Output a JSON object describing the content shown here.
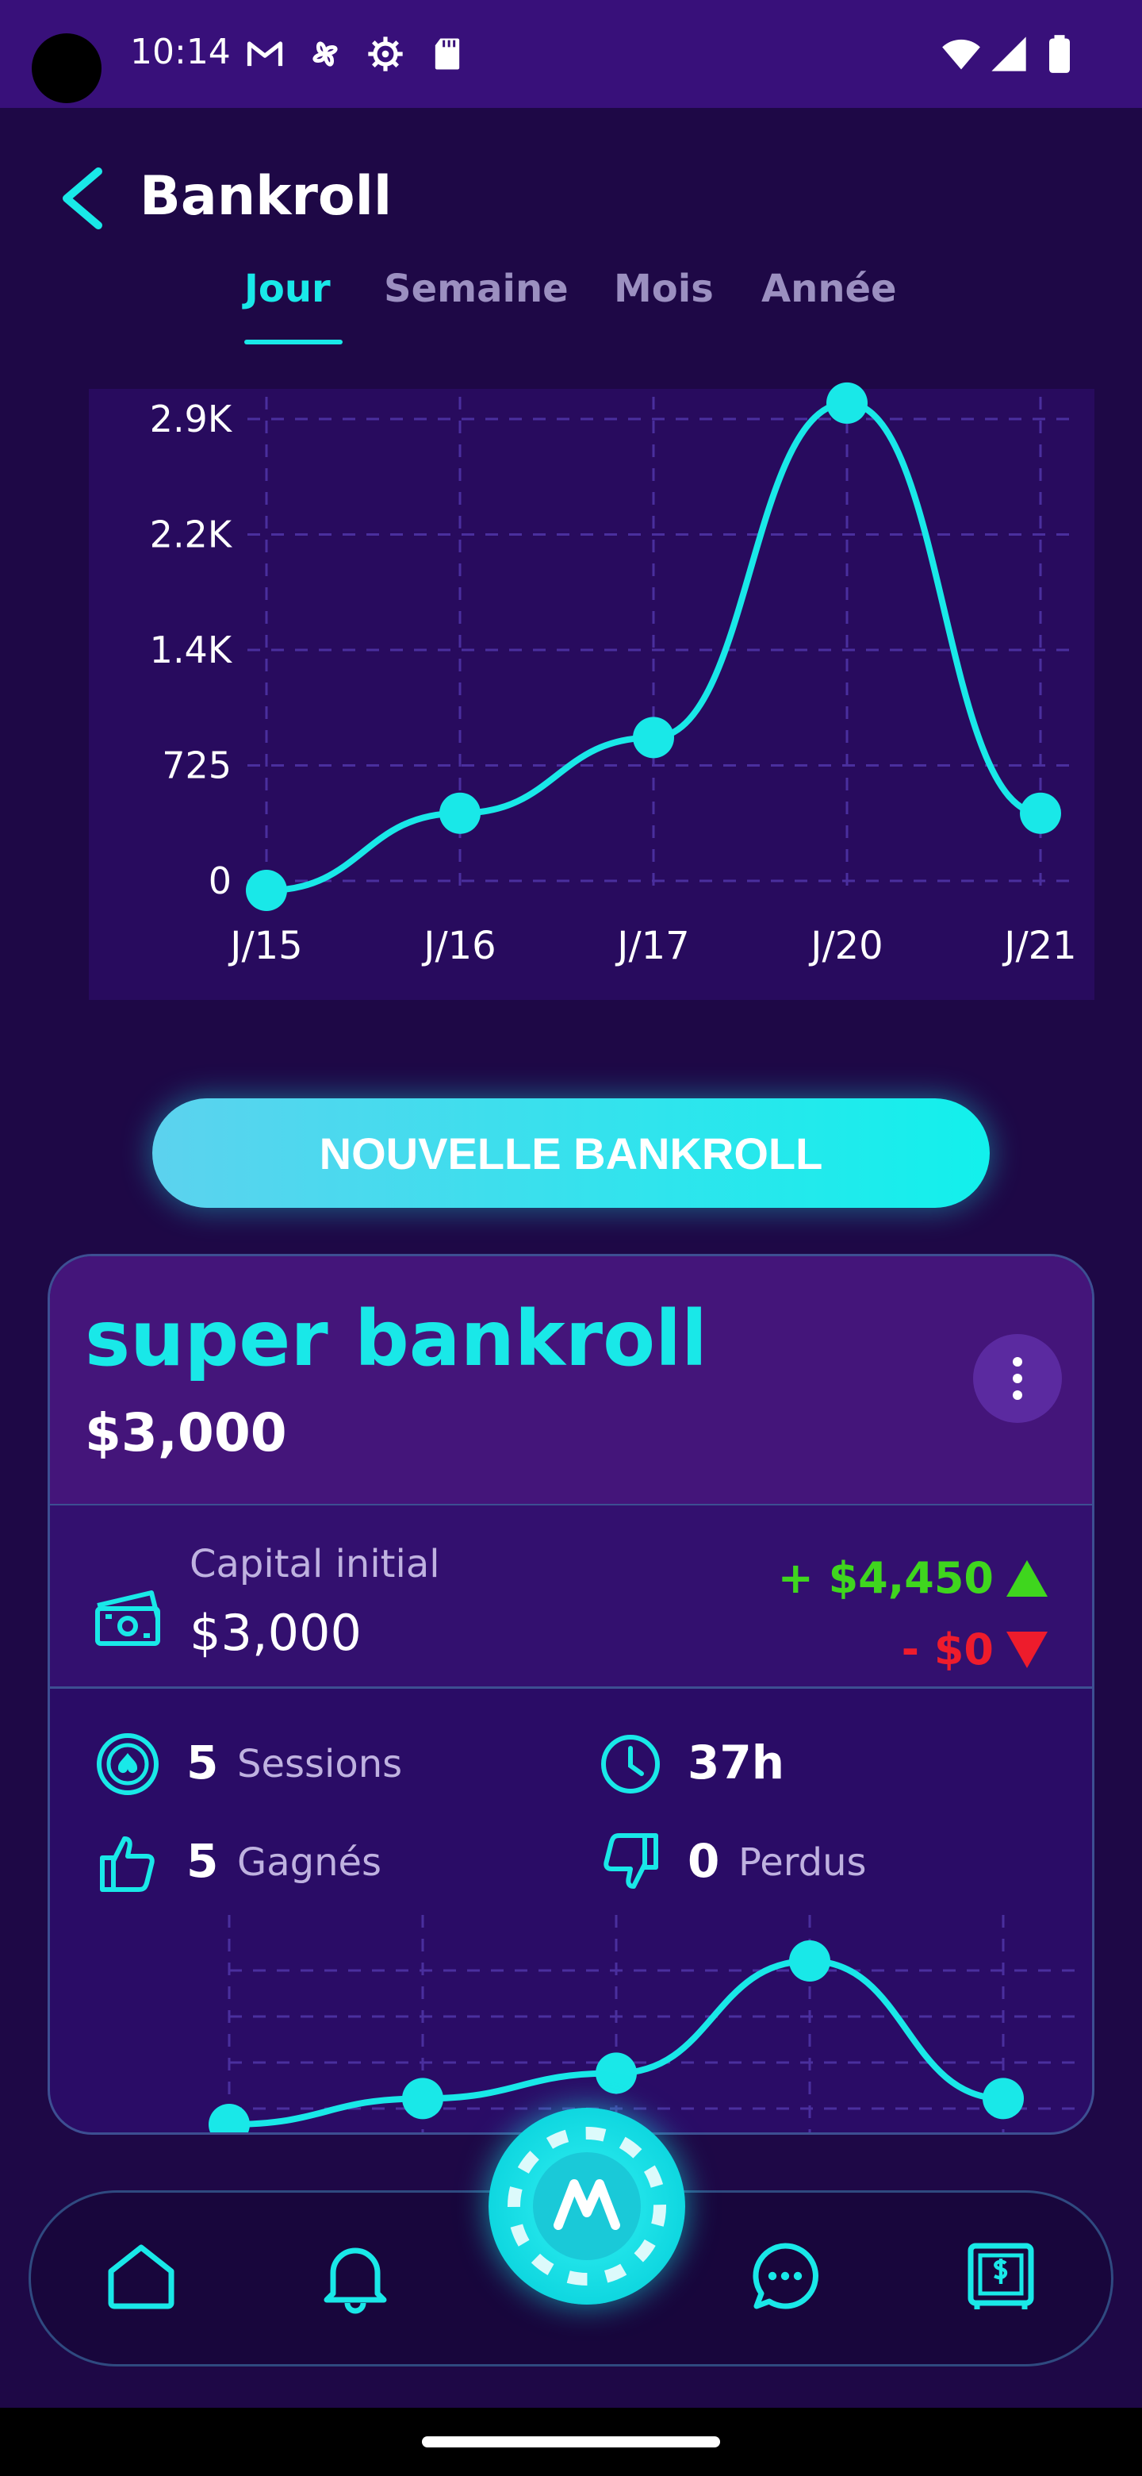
{
  "status_bar": {
    "time": "10:14",
    "left_icons": [
      "gmail-icon",
      "pinwheel-icon",
      "settings-icon",
      "sd-card-icon"
    ],
    "right_icons": [
      "wifi-icon",
      "signal-icon",
      "battery-icon"
    ]
  },
  "header": {
    "title": "Bankroll",
    "back_icon": "chevron-left-icon"
  },
  "tabs": [
    {
      "label": "Jour",
      "active": true
    },
    {
      "label": "Semaine",
      "active": false
    },
    {
      "label": "Mois",
      "active": false
    },
    {
      "label": "Année",
      "active": false
    }
  ],
  "chart_data": {
    "type": "line",
    "title": "",
    "xlabel": "",
    "ylabel": "",
    "categories": [
      "J/15",
      "J/16",
      "J/17",
      "J/20",
      "J/21"
    ],
    "values": [
      -60,
      425,
      900,
      3000,
      425
    ],
    "y_ticks": [
      "2.9K",
      "2.2K",
      "1.4K",
      "725",
      "0"
    ],
    "y_tick_values": [
      2900,
      2175,
      1450,
      725,
      0
    ],
    "ylim": [
      0,
      2900
    ],
    "grid": true,
    "line_color": "#19e8e8"
  },
  "new_bankroll_button": "NOUVELLE BANKROLL",
  "bankroll_card": {
    "name": "super bankroll",
    "balance": "$3,000",
    "menu_icon": "more-vertical-icon",
    "capital_label": "Capital initial",
    "capital_value": "$3,000",
    "gain": "+ $4,450",
    "loss": "- $0",
    "stats": {
      "sessions_count": "5",
      "sessions_label": "Sessions",
      "duration": "37h",
      "won_count": "5",
      "won_label": "Gagnés",
      "lost_count": "0",
      "lost_label": "Perdus"
    },
    "mini_chart": {
      "type": "line",
      "values": [
        -60,
        425,
        900,
        3000,
        425
      ],
      "line_color": "#19e8e8"
    }
  },
  "bottom_nav": {
    "items": [
      "home-icon",
      "bell-icon",
      "poker-chip-icon",
      "chat-icon",
      "safe-icon"
    ]
  },
  "colors": {
    "accent": "#19e8e8",
    "background": "#1e0846",
    "gain": "#3fd61e",
    "loss": "#ee1c2c"
  }
}
